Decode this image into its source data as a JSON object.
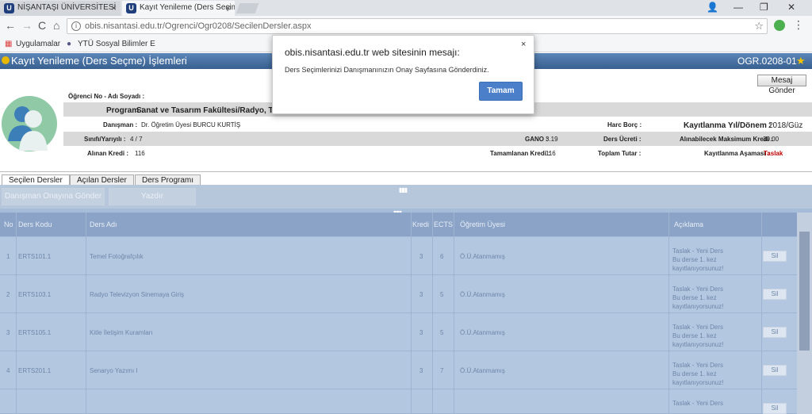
{
  "browser": {
    "tabs": [
      {
        "title": "NİŞANTAŞI ÜNİVERSİTESİ",
        "favicon": "U"
      },
      {
        "title": "Kayıt Yenileme (Ders Seçim",
        "favicon": "U"
      }
    ],
    "tab_close": "×",
    "window_controls": {
      "account": "👤",
      "minimize": "—",
      "restore": "❐",
      "close": "✕"
    },
    "nav": {
      "back": "←",
      "forward": "→",
      "reload": "C",
      "home": "⌂"
    },
    "url": "obis.nisantasi.edu.tr/Ogrenci/Ogr0208/SecilenDersler.aspx",
    "bookmarks": [
      {
        "label": "Uygulamalar",
        "icon": "apps-icon"
      },
      {
        "label": "YTÜ Sosyal Bilimler E",
        "icon": "globe-icon"
      }
    ]
  },
  "dialog": {
    "title": "obis.nisantasi.edu.tr web sitesinin mesajı:",
    "message": "Ders Seçimlerinizi Danışmanınızın Onay Sayfasına Gönderdiniz.",
    "ok_label": "Tamam",
    "close": "×"
  },
  "header": {
    "title": "Kayıt Yenileme (Ders Seçme) İşlemleri",
    "code": "OGR.0208-01",
    "message_button": "Mesaj Gönder"
  },
  "student": {
    "no_label": "Öğrenci No - Adı Soyadı :",
    "program_label": "Program :",
    "program_value": "Sanat ve Tasarım Fakültesi/Radyo, Televiz",
    "advisor_label": "Danışman :",
    "advisor_value": "Dr. Öğretim Üyesi BURCU KURTİŞ",
    "harc_label": "Harc Borç :",
    "term_label": "Kayıtlanma Yıl/Dönem :",
    "term_value": "2018/Güz",
    "class_label": "Sınıfı/Yarıyılı :",
    "class_value": "4 / 7",
    "gano_label": "GANO :",
    "gano_value": "3.19",
    "fee_label": "Ders Ücreti :",
    "max_credit_label": "Alınabilecek Maksimum Kredi :",
    "max_credit_value": "30.00",
    "taken_credit_label": "Alınan Kredi :",
    "taken_credit_value": "116",
    "completed_credit_label": "Tamamlanan Kredi :",
    "completed_credit_value": "116",
    "total_label": "Toplam Tutar :",
    "stage_label": "Kayıtlanma Aşaması :",
    "stage_value": "Taslak"
  },
  "tabs": [
    "Seçilen Dersler",
    "Açılan Dersler",
    "Ders Programı"
  ],
  "actions": {
    "send": "Danışman Onayına Gönder",
    "print": "Yazdır"
  },
  "grid": {
    "columns": {
      "no": "No",
      "code": "Ders Kodu",
      "name": "Ders Adı",
      "credit": "Kredi",
      "ects": "ECTS",
      "teacher": "Öğretim Üyesi",
      "note": "Açıklama"
    },
    "rows": [
      {
        "no": "1",
        "code": "ERTS101.1",
        "name": "Temel Fotoğrafçılık",
        "credit": "3",
        "ects": "6",
        "teacher": "Ö.Ü.Atanmamış",
        "note1": "Taslak - Yeni Ders",
        "note2": "Bu derse 1. kez",
        "note3": "kayıtlanıyorsunuz!",
        "delete": "Sil"
      },
      {
        "no": "2",
        "code": "ERTS103.1",
        "name": "Radyo Televizyon Sinemaya Giriş",
        "credit": "3",
        "ects": "5",
        "teacher": "Ö.Ü.Atanmamış",
        "note1": "Taslak - Yeni Ders",
        "note2": "Bu derse 1. kez",
        "note3": "kayıtlanıyorsunuz!",
        "delete": "Sil"
      },
      {
        "no": "3",
        "code": "ERTS105.1",
        "name": "Kitle İletişim Kuramları",
        "credit": "3",
        "ects": "5",
        "teacher": "Ö.Ü.Atanmamış",
        "note1": "Taslak - Yeni Ders",
        "note2": "Bu derse 1. kez",
        "note3": "kayıtlanıyorsunuz!",
        "delete": "Sil"
      },
      {
        "no": "4",
        "code": "ERTS201.1",
        "name": "Senaryo Yazımı I",
        "credit": "3",
        "ects": "7",
        "teacher": "Ö.Ü.Atanmamış",
        "note1": "Taslak - Yeni Ders",
        "note2": "Bu derse 1. kez",
        "note3": "kayıtlanıyorsunuz!",
        "delete": "Sil"
      },
      {
        "no": "",
        "code": "",
        "name": "",
        "credit": "",
        "ects": "",
        "teacher": "",
        "note1": "Taslak - Yeni Ders",
        "note2": "",
        "note3": "",
        "delete": "Sil"
      }
    ]
  },
  "colors": {
    "header_blue": "#375f90",
    "grid_blue": "#b3c7e1",
    "dialog_button": "#4b7fc9",
    "draft_red": "#c00000"
  }
}
